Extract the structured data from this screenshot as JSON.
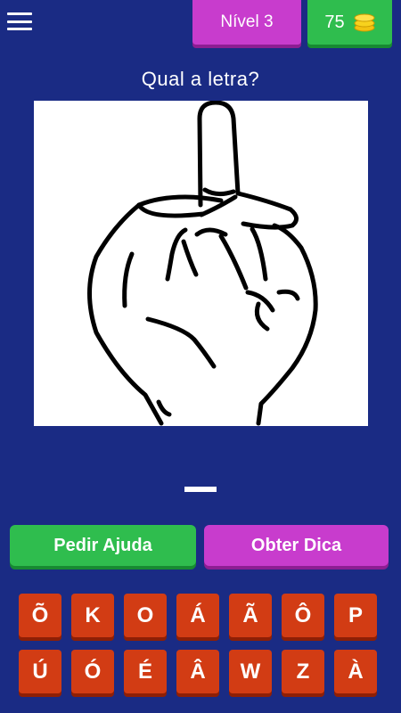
{
  "header": {
    "level_label": "Nível 3",
    "coins": "75"
  },
  "question": "Qual a letra?",
  "picture": {
    "description_icon": "hand-sign-icon"
  },
  "buttons": {
    "help": "Pedir Ajuda",
    "hint": "Obter Dica"
  },
  "letters": [
    "Õ",
    "K",
    "O",
    "Á",
    "Ã",
    "Ô",
    "P",
    "Ú",
    "Ó",
    "É",
    "Â",
    "W",
    "Z",
    "À"
  ],
  "colors": {
    "background": "#1a2b84",
    "level_badge": "#c83ccd",
    "coins_badge": "#2fbd4e",
    "key": "#d23c14"
  }
}
